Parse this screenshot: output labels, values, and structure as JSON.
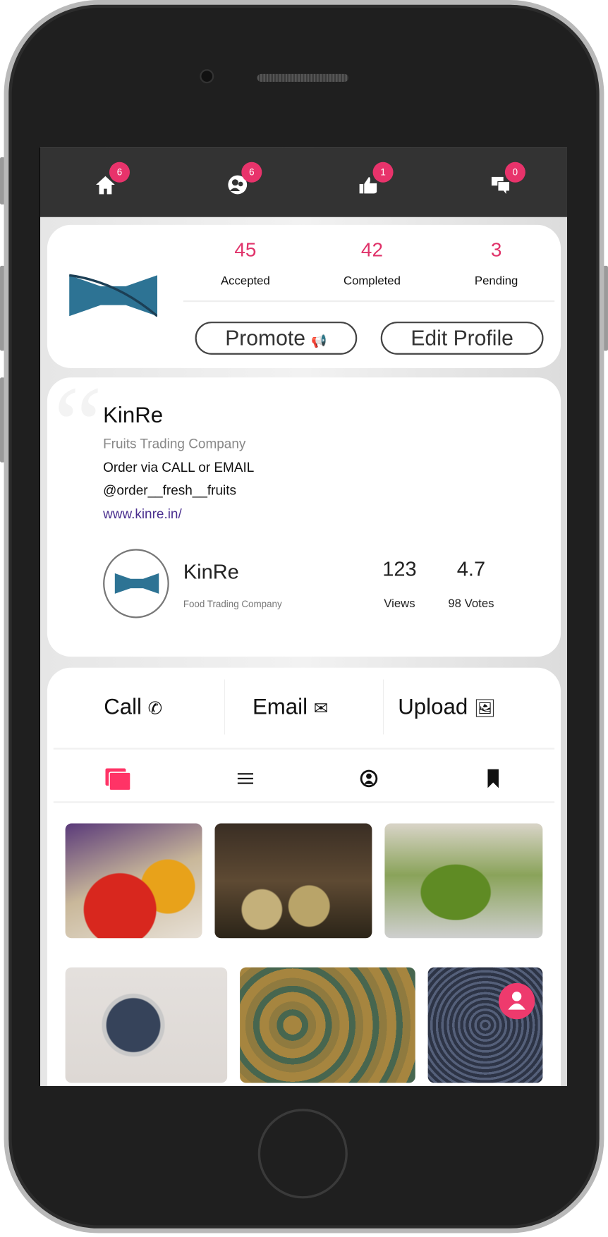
{
  "nav": {
    "items": [
      {
        "icon": "home-icon",
        "badge": "6"
      },
      {
        "icon": "users-icon",
        "badge": "6"
      },
      {
        "icon": "thumbs-up-icon",
        "badge": "1"
      },
      {
        "icon": "chat-icon",
        "badge": "0"
      }
    ]
  },
  "stats": [
    {
      "value": "45",
      "label": "Accepted"
    },
    {
      "value": "42",
      "label": "Completed"
    },
    {
      "value": "3",
      "label": "Pending"
    }
  ],
  "actions": {
    "promote": "Promote",
    "edit_profile": "Edit Profile"
  },
  "profile": {
    "name": "KinRe",
    "category": "Fruits Trading Company",
    "line1": "Order via CALL or EMAIL",
    "line2": "@order__fresh__fruits",
    "website": "www.kinre.in/",
    "card_name": "KinRe",
    "card_subtitle": "Food Trading Company",
    "views": "123",
    "views_label": "Views",
    "rating": "4.7",
    "votes_label": "98 Votes"
  },
  "contact": {
    "call": "Call",
    "email": "Email",
    "upload": "Upload"
  },
  "tabs": [
    "grid-icon",
    "list-icon",
    "profile-icon",
    "bookmark-icon"
  ],
  "colors": {
    "accent": "#e8336b",
    "nav_bg": "#333333",
    "link": "#4a2f8f"
  }
}
